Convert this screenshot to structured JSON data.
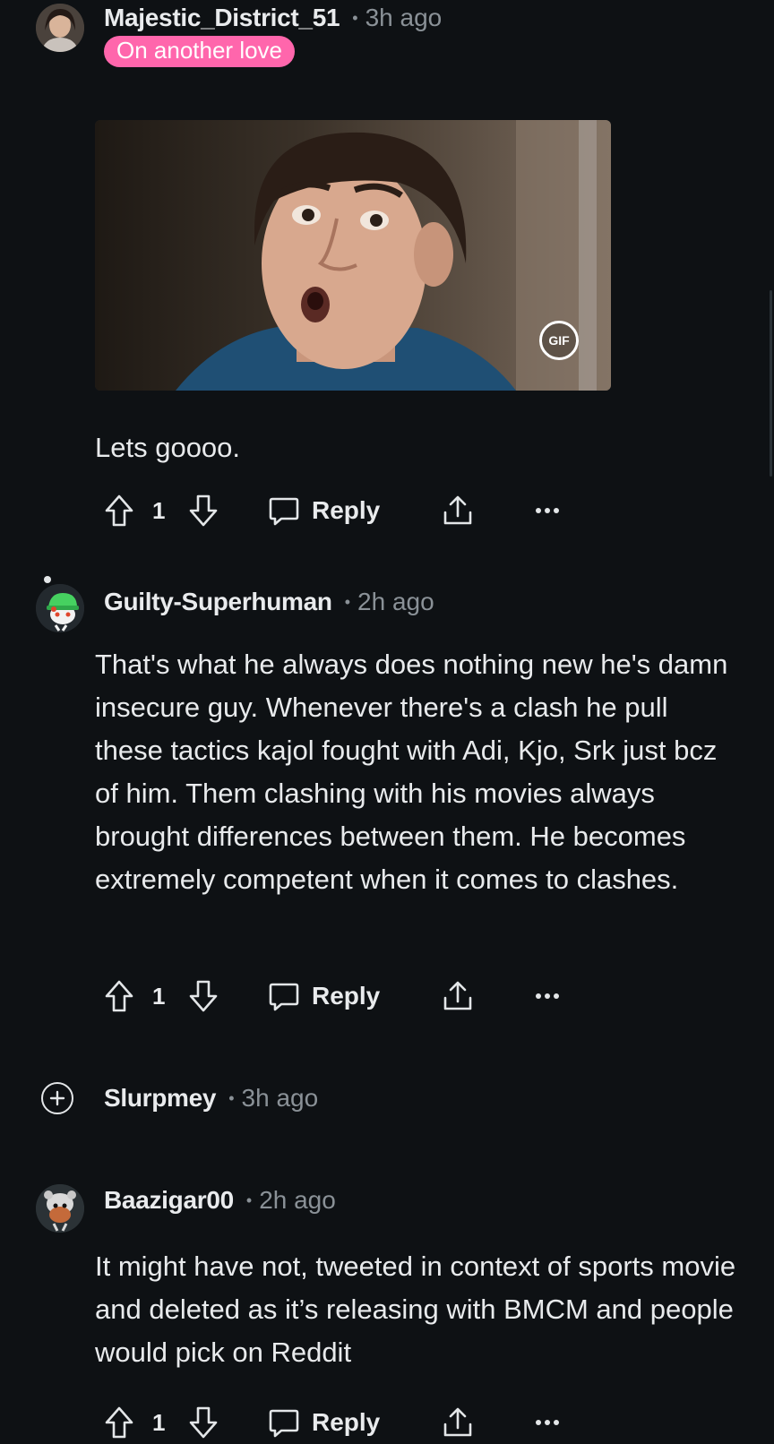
{
  "comments": [
    {
      "username": "Majestic_District_51",
      "time": "3h ago",
      "flair": "On another love",
      "media_badge": "GIF",
      "text": "Lets goooo.",
      "votes": "1",
      "reply_label": "Reply",
      "avatar": "woman-photo-avatar"
    },
    {
      "username": "Guilty-Superhuman",
      "time": "2h ago",
      "text": "That's what he always does nothing new he's damn insecure guy. Whenever there's a clash he pull these tactics kajol fought with Adi, Kjo, Srk just bcz of him. Them clashing with his movies always brought differences between them. He becomes extremely competent when it comes to clashes.",
      "votes": "1",
      "reply_label": "Reply",
      "avatar": "snoo-green-hat-avatar"
    },
    {
      "username": "Slurpmey",
      "time": "3h ago",
      "collapsed": true
    },
    {
      "username": "Baazigar00",
      "time": "2h ago",
      "text": "It might have not, tweeted in context of sports movie and deleted as it’s releasing with BMCM and people would pick on Reddit",
      "votes": "1",
      "reply_label": "Reply",
      "avatar": "snoo-grey-avatar"
    }
  ],
  "colors": {
    "background": "#0e1114",
    "flair_bg": "#ff66ac",
    "text": "#e8eaec",
    "meta": "#8a9197"
  },
  "icons": [
    "upvote-icon",
    "downvote-icon",
    "comment-bubble-icon",
    "share-icon",
    "more-options-icon",
    "expand-plus-icon"
  ]
}
